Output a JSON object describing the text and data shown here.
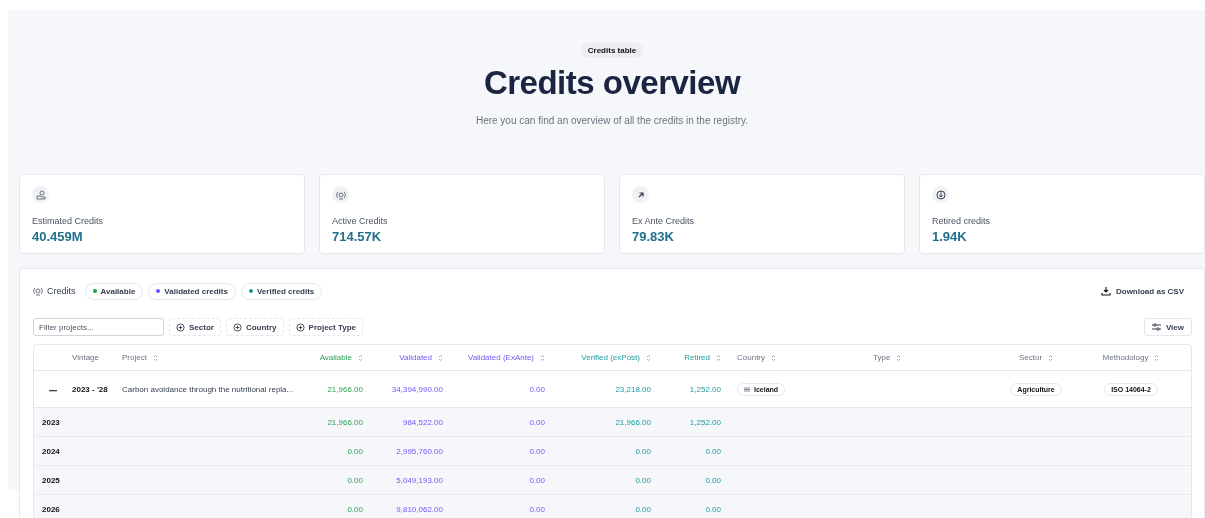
{
  "header": {
    "badge": "Credits table",
    "title": "Credits overview",
    "subtitle": "Here you can find an overview of all the credits in the registry."
  },
  "stats": [
    {
      "kind": "estimated",
      "label": "Estimated Credits",
      "value": "40.459M"
    },
    {
      "kind": "active",
      "label": "Active Credits",
      "value": "714.57K"
    },
    {
      "kind": "exante",
      "label": "Ex Ante Credits",
      "value": "79.83K"
    },
    {
      "kind": "retired",
      "label": "Retired credits",
      "value": "1.94K"
    }
  ],
  "credits": {
    "title": "Credits",
    "legend": [
      {
        "label": "Available",
        "color": "#16a34a"
      },
      {
        "label": "Validated credits",
        "color": "#6d4aff"
      },
      {
        "label": "Verified credits",
        "color": "#0f9a9a"
      }
    ],
    "download": "Download as CSV",
    "filter": {
      "placeholder": "Filter projects..."
    },
    "filter_buttons": [
      "Sector",
      "Country",
      "Project Type"
    ],
    "view_button": "View"
  },
  "table": {
    "columns": [
      {
        "label": "Vintage",
        "kind": "plain",
        "sortable": false
      },
      {
        "label": "Project",
        "kind": "plain",
        "sortable": true
      },
      {
        "label": "Available",
        "kind": "available",
        "sortable": true
      },
      {
        "label": "Validated",
        "kind": "validated",
        "sortable": true
      },
      {
        "label": "Validated (ExAnte)",
        "kind": "validated",
        "sortable": true
      },
      {
        "label": "Verified (exPost)",
        "kind": "verified",
        "sortable": true
      },
      {
        "label": "Retired",
        "kind": "verified",
        "sortable": true
      },
      {
        "label": "Country",
        "kind": "plain",
        "sortable": true
      },
      {
        "label": "Type",
        "kind": "plain",
        "sortable": true
      },
      {
        "label": "Sector",
        "kind": "plain",
        "sortable": true
      },
      {
        "label": "Methodology",
        "kind": "plain",
        "sortable": true
      }
    ],
    "rows": [
      {
        "expanded": true,
        "vintage": "2023 - '28",
        "project": "Carbon avoidance through the nutritional repla...",
        "values": [
          "21,966.00",
          "34,394,990.00",
          "0.00",
          "23,218.00",
          "1,252.00"
        ],
        "country": "Iceland",
        "sector": "Agriculture",
        "methodology": "ISO 14064-2",
        "children": [
          {
            "vintage": "2023",
            "values": [
              "21,966.00",
              "984,522.00",
              "0.00",
              "21,966.00",
              "1,252.00"
            ]
          },
          {
            "vintage": "2024",
            "values": [
              "0.00",
              "2,995,760.00",
              "0.00",
              "0.00",
              "0.00"
            ]
          },
          {
            "vintage": "2025",
            "values": [
              "0.00",
              "5,049,193.00",
              "0.00",
              "0.00",
              "0.00"
            ]
          },
          {
            "vintage": "2026",
            "values": [
              "0.00",
              "9,810,062.00",
              "0.00",
              "0.00",
              "0.00"
            ]
          }
        ]
      }
    ]
  }
}
